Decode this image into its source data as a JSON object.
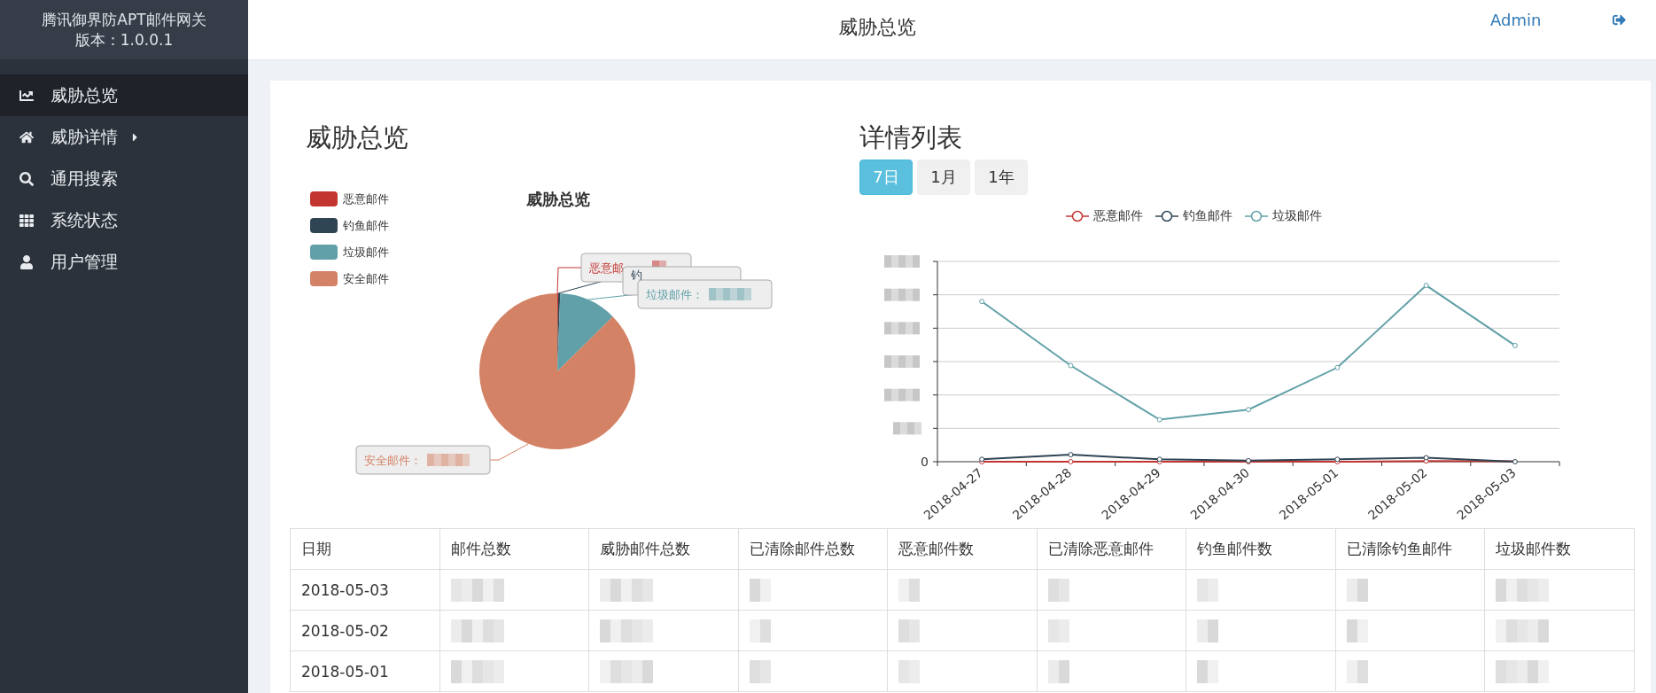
{
  "sidebar": {
    "product": "腾讯御界防APT邮件网关",
    "version": "版本：1.0.0.1",
    "items": [
      {
        "label": "威胁总览",
        "selected": true
      },
      {
        "label": "威胁详情",
        "selected": false,
        "kind": "submenu",
        "expanded": false
      },
      {
        "label": "通用搜索",
        "selected": false
      },
      {
        "label": "系统状态",
        "selected": false
      },
      {
        "label": "用户管理",
        "selected": false
      }
    ]
  },
  "header": {
    "title": "威胁总览",
    "user": "Admin"
  },
  "overview": {
    "heading": "威胁总览",
    "pie": {
      "title": "威胁总览",
      "legend": [
        {
          "label": "恶意邮件",
          "color": "#c23531"
        },
        {
          "label": "钓鱼邮件",
          "color": "#2f4554"
        },
        {
          "label": "垃圾邮件",
          "color": "#61a0a8"
        },
        {
          "label": "安全邮件",
          "color": "#d48265"
        }
      ],
      "callouts": [
        {
          "text": "恶意邮"
        },
        {
          "text": "钓"
        },
        {
          "text": "垃圾邮件："
        },
        {
          "text": "安全邮件："
        }
      ]
    }
  },
  "details": {
    "heading": "详情列表",
    "ranges": [
      {
        "label": "7日",
        "selected": true
      },
      {
        "label": "1月",
        "selected": false
      },
      {
        "label": "1年",
        "selected": false
      }
    ],
    "legend": [
      {
        "label": "恶意邮件",
        "color": "#c23531"
      },
      {
        "label": "钓鱼邮件",
        "color": "#2f4554"
      },
      {
        "label": "垃圾邮件",
        "color": "#61a0a8"
      }
    ],
    "x_labels": [
      "2018-04-27",
      "2018-04-28",
      "2018-04-29",
      "2018-04-30",
      "2018-05-01",
      "2018-05-02",
      "2018-05-03"
    ],
    "y_zero": "0"
  },
  "table": {
    "columns": [
      "日期",
      "邮件总数",
      "威胁邮件总数",
      "已清除邮件总数",
      "恶意邮件数",
      "已清除恶意邮件",
      "钓鱼邮件数",
      "已清除钓鱼邮件",
      "垃圾邮件数"
    ],
    "rows": [
      {
        "date": "2018-05-03"
      },
      {
        "date": "2018-05-02"
      },
      {
        "date": "2018-05-01"
      }
    ]
  }
}
